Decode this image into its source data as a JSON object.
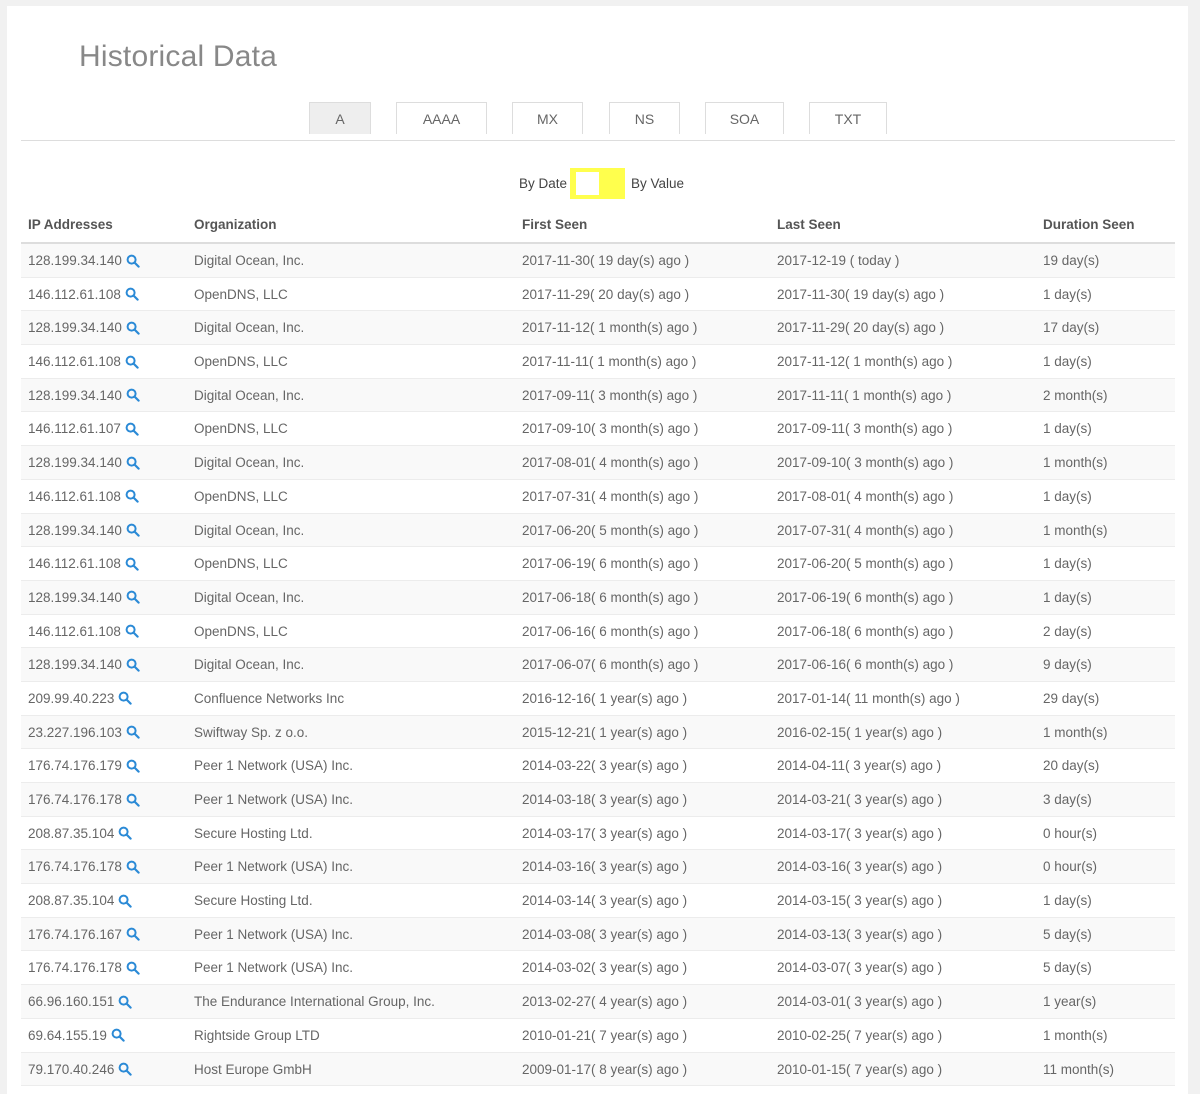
{
  "page": {
    "title": "Historical Data"
  },
  "tabs": [
    "A",
    "AAAA",
    "MX",
    "NS",
    "SOA",
    "TXT"
  ],
  "active_tab": "A",
  "toggle": {
    "left_label": "By Date",
    "right_label": "By Value",
    "color": "#ffff4d"
  },
  "columns": [
    "IP Addresses",
    "Organization",
    "First Seen",
    "Last Seen",
    "Duration Seen"
  ],
  "icon_color": "#2b8ad6",
  "rows": [
    [
      "128.199.34.140",
      "Digital Ocean, Inc.",
      "2017-11-30( 19 day(s) ago )",
      "2017-12-19 ( today )",
      "19 day(s)"
    ],
    [
      "146.112.61.108",
      "OpenDNS, LLC",
      "2017-11-29( 20 day(s) ago )",
      "2017-11-30( 19 day(s) ago )",
      "1 day(s)"
    ],
    [
      "128.199.34.140",
      "Digital Ocean, Inc.",
      "2017-11-12( 1 month(s) ago )",
      "2017-11-29( 20 day(s) ago )",
      "17 day(s)"
    ],
    [
      "146.112.61.108",
      "OpenDNS, LLC",
      "2017-11-11( 1 month(s) ago )",
      "2017-11-12( 1 month(s) ago )",
      "1 day(s)"
    ],
    [
      "128.199.34.140",
      "Digital Ocean, Inc.",
      "2017-09-11( 3 month(s) ago )",
      "2017-11-11( 1 month(s) ago )",
      "2 month(s)"
    ],
    [
      "146.112.61.107",
      "OpenDNS, LLC",
      "2017-09-10( 3 month(s) ago )",
      "2017-09-11( 3 month(s) ago )",
      "1 day(s)"
    ],
    [
      "128.199.34.140",
      "Digital Ocean, Inc.",
      "2017-08-01( 4 month(s) ago )",
      "2017-09-10( 3 month(s) ago )",
      "1 month(s)"
    ],
    [
      "146.112.61.108",
      "OpenDNS, LLC",
      "2017-07-31( 4 month(s) ago )",
      "2017-08-01( 4 month(s) ago )",
      "1 day(s)"
    ],
    [
      "128.199.34.140",
      "Digital Ocean, Inc.",
      "2017-06-20( 5 month(s) ago )",
      "2017-07-31( 4 month(s) ago )",
      "1 month(s)"
    ],
    [
      "146.112.61.108",
      "OpenDNS, LLC",
      "2017-06-19( 6 month(s) ago )",
      "2017-06-20( 5 month(s) ago )",
      "1 day(s)"
    ],
    [
      "128.199.34.140",
      "Digital Ocean, Inc.",
      "2017-06-18( 6 month(s) ago )",
      "2017-06-19( 6 month(s) ago )",
      "1 day(s)"
    ],
    [
      "146.112.61.108",
      "OpenDNS, LLC",
      "2017-06-16( 6 month(s) ago )",
      "2017-06-18( 6 month(s) ago )",
      "2 day(s)"
    ],
    [
      "128.199.34.140",
      "Digital Ocean, Inc.",
      "2017-06-07( 6 month(s) ago )",
      "2017-06-16( 6 month(s) ago )",
      "9 day(s)"
    ],
    [
      "209.99.40.223",
      "Confluence Networks Inc",
      "2016-12-16( 1 year(s) ago )",
      "2017-01-14( 11 month(s) ago )",
      "29 day(s)"
    ],
    [
      "23.227.196.103",
      "Swiftway Sp. z o.o.",
      "2015-12-21( 1 year(s) ago )",
      "2016-02-15( 1 year(s) ago )",
      "1 month(s)"
    ],
    [
      "176.74.176.179",
      "Peer 1 Network (USA) Inc.",
      "2014-03-22( 3 year(s) ago )",
      "2014-04-11( 3 year(s) ago )",
      "20 day(s)"
    ],
    [
      "176.74.176.178",
      "Peer 1 Network (USA) Inc.",
      "2014-03-18( 3 year(s) ago )",
      "2014-03-21( 3 year(s) ago )",
      "3 day(s)"
    ],
    [
      "208.87.35.104",
      "Secure Hosting Ltd.",
      "2014-03-17( 3 year(s) ago )",
      "2014-03-17( 3 year(s) ago )",
      "0 hour(s)"
    ],
    [
      "176.74.176.178",
      "Peer 1 Network (USA) Inc.",
      "2014-03-16( 3 year(s) ago )",
      "2014-03-16( 3 year(s) ago )",
      "0 hour(s)"
    ],
    [
      "208.87.35.104",
      "Secure Hosting Ltd.",
      "2014-03-14( 3 year(s) ago )",
      "2014-03-15( 3 year(s) ago )",
      "1 day(s)"
    ],
    [
      "176.74.176.167",
      "Peer 1 Network (USA) Inc.",
      "2014-03-08( 3 year(s) ago )",
      "2014-03-13( 3 year(s) ago )",
      "5 day(s)"
    ],
    [
      "176.74.176.178",
      "Peer 1 Network (USA) Inc.",
      "2014-03-02( 3 year(s) ago )",
      "2014-03-07( 3 year(s) ago )",
      "5 day(s)"
    ],
    [
      "66.96.160.151",
      "The Endurance International Group, Inc.",
      "2013-02-27( 4 year(s) ago )",
      "2014-03-01( 3 year(s) ago )",
      "1 year(s)"
    ],
    [
      "69.64.155.19",
      "Rightside Group LTD",
      "2010-01-21( 7 year(s) ago )",
      "2010-02-25( 7 year(s) ago )",
      "1 month(s)"
    ],
    [
      "79.170.40.246",
      "Host Europe GmbH",
      "2009-01-17( 8 year(s) ago )",
      "2010-01-15( 7 year(s) ago )",
      "11 month(s)"
    ]
  ]
}
